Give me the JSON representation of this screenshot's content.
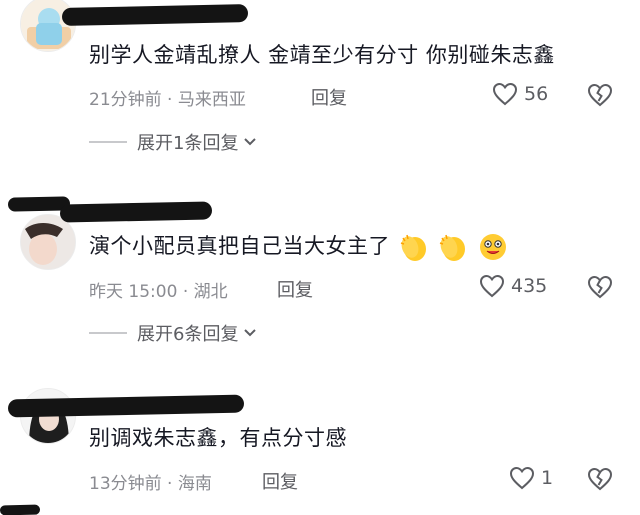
{
  "comments": [
    {
      "text": "别学人金靖乱撩人 金靖至少有分寸 你别碰朱志鑫",
      "time": "21分钟前",
      "location": "· 马来西亚",
      "reply_label": "回复",
      "likes": "56",
      "expand_label": "展开1条回复"
    },
    {
      "text": "演个小配员真把自己当大女主了",
      "emojis": [
        "clapping-hands-emoji",
        "clapping-hands-emoji",
        "dizzy-face-emoji"
      ],
      "time": "昨天 15:00",
      "location": "· 湖北",
      "reply_label": "回复",
      "likes": "435",
      "expand_label": "展开6条回复"
    },
    {
      "text": "别调戏朱志鑫，有点分寸感",
      "time": "13分钟前",
      "location": "· 海南",
      "reply_label": "回复",
      "likes": "1"
    }
  ],
  "colors": {
    "text": "#161823",
    "meta": "#8a8b91",
    "icon": "#5c5d62"
  }
}
